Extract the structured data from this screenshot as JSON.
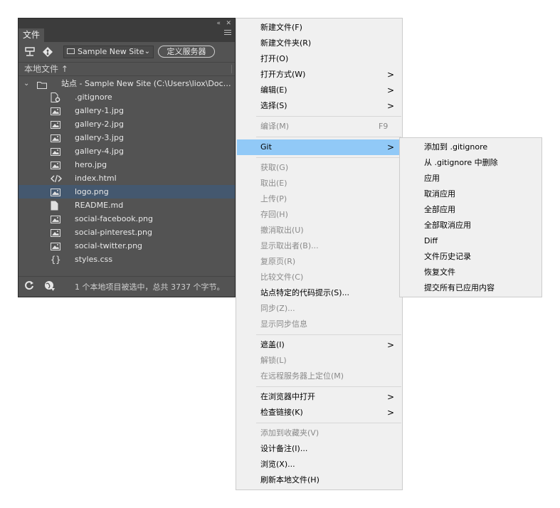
{
  "panel": {
    "topbar": {
      "collapse_glyph": "«",
      "close_glyph": "✕"
    },
    "tab_label": "文件",
    "menu_icon": "panel-menu-icon",
    "toolbar": {
      "site_name": "Sample New Site",
      "define_server_label": "定义服务器",
      "connect_icon": "connect-icon",
      "git_icon": "git-icon"
    },
    "local_files_label": "本地文件 ↑",
    "root": {
      "label": "站点 - Sample New Site (C:\\Users\\liox\\Documen..."
    },
    "files": [
      {
        "name": ".gitignore",
        "icon": "settings-file"
      },
      {
        "name": "gallery-1.jpg",
        "icon": "image-file"
      },
      {
        "name": "gallery-2.jpg",
        "icon": "image-file"
      },
      {
        "name": "gallery-3.jpg",
        "icon": "image-file"
      },
      {
        "name": "gallery-4.jpg",
        "icon": "image-file"
      },
      {
        "name": "hero.jpg",
        "icon": "image-file"
      },
      {
        "name": "index.html",
        "icon": "code-file"
      },
      {
        "name": "logo.png",
        "icon": "image-file",
        "selected": true
      },
      {
        "name": "README.md",
        "icon": "document-file"
      },
      {
        "name": "social-facebook.png",
        "icon": "image-file"
      },
      {
        "name": "social-pinterest.png",
        "icon": "image-file"
      },
      {
        "name": "social-twitter.png",
        "icon": "image-file"
      },
      {
        "name": "styles.css",
        "icon": "css-file"
      }
    ],
    "status_text": "1 个本地项目被选中，总共 3737 个字节。"
  },
  "menu": {
    "items": [
      {
        "label": "新建文件(F)",
        "enabled": true
      },
      {
        "label": "新建文件夹(R)",
        "enabled": true
      },
      {
        "label": "打开(O)",
        "enabled": true
      },
      {
        "label": "打开方式(W)",
        "enabled": true,
        "arrow": ">"
      },
      {
        "label": "编辑(E)",
        "enabled": true,
        "arrow": ">"
      },
      {
        "label": "选择(S)",
        "enabled": true,
        "arrow": ">"
      },
      {
        "label": "编译(M)",
        "enabled": false,
        "shortcut": "F9"
      },
      {
        "label": "Git",
        "enabled": true,
        "arrow": ">",
        "highlighted": true
      },
      {
        "label": "获取(G)",
        "enabled": false
      },
      {
        "label": "取出(E)",
        "enabled": false
      },
      {
        "label": "上传(P)",
        "enabled": false
      },
      {
        "label": "存回(H)",
        "enabled": false
      },
      {
        "label": "撤消取出(U)",
        "enabled": false
      },
      {
        "label": "显示取出者(B)...",
        "enabled": false
      },
      {
        "label": "复原页(R)",
        "enabled": false
      },
      {
        "label": "比较文件(C)",
        "enabled": false
      },
      {
        "label": "站点特定的代码提示(S)...",
        "enabled": true
      },
      {
        "label": "同步(Z)...",
        "enabled": false
      },
      {
        "label": "显示同步信息",
        "enabled": false
      },
      {
        "label": "遮盖(I)",
        "enabled": true,
        "arrow": ">"
      },
      {
        "label": "解锁(L)",
        "enabled": false
      },
      {
        "label": "在远程服务器上定位(M)",
        "enabled": false
      },
      {
        "label": "在浏览器中打开",
        "enabled": true,
        "arrow": ">"
      },
      {
        "label": "检查链接(K)",
        "enabled": true,
        "arrow": ">"
      },
      {
        "label": "添加到收藏夹(V)",
        "enabled": false
      },
      {
        "label": "设计备注(I)...",
        "enabled": true
      },
      {
        "label": "浏览(X)...",
        "enabled": true
      },
      {
        "label": "刷新本地文件(H)",
        "enabled": true
      }
    ]
  },
  "git_submenu": {
    "items": [
      "添加到 .gitignore",
      "从 .gitignore 中删除",
      "应用",
      "取消应用",
      "全部应用",
      "全部取消应用",
      "Diff",
      "文件历史记录",
      "恢复文件",
      "提交所有已应用内容"
    ]
  },
  "colors": {
    "panel_bg": "#535353",
    "selection": "#44586f",
    "menu_bg": "#f0f0f0",
    "menu_highlight": "#91c9f7",
    "disabled_text": "#8a8a8a"
  }
}
